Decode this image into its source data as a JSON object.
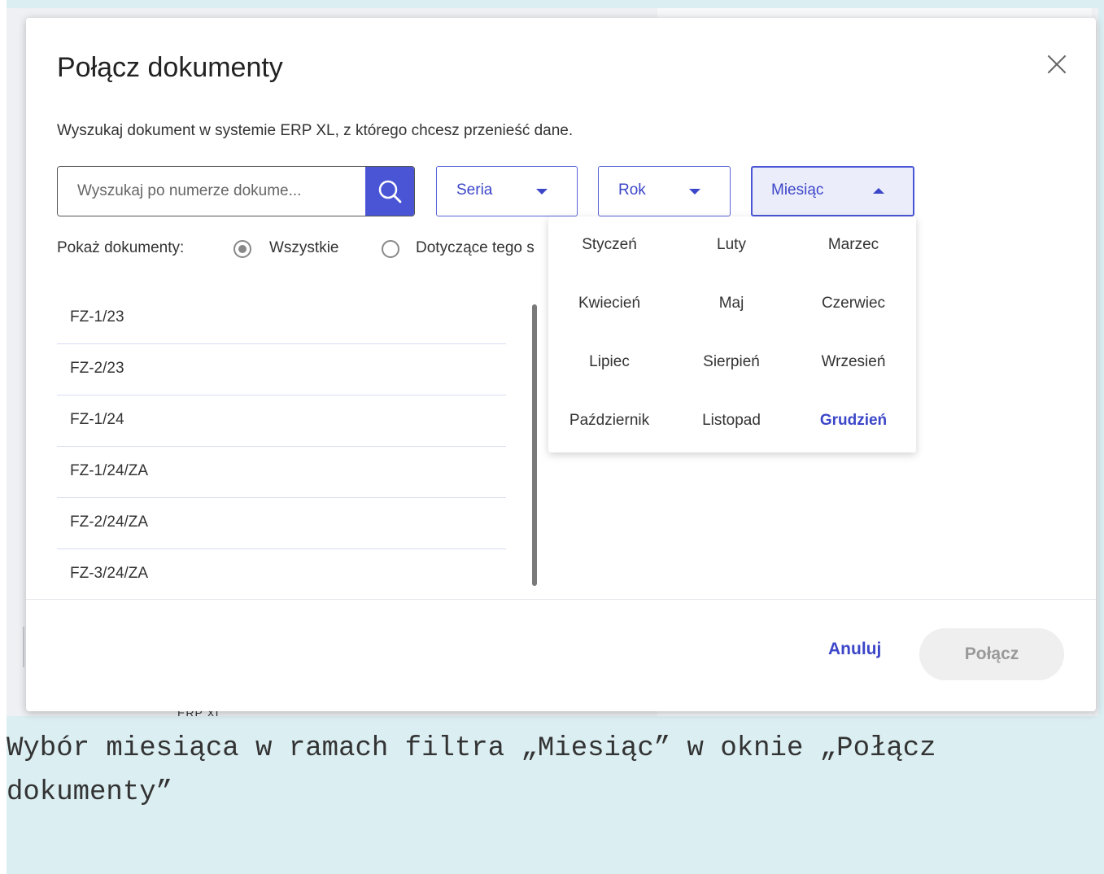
{
  "background": {
    "label": "ERP XL"
  },
  "dialog": {
    "title": "Połącz dokumenty",
    "subtitle": "Wyszukaj dokument w systemie ERP XL, z którego chcesz przenieść dane.",
    "search": {
      "placeholder": "Wyszukaj po numerze dokume..."
    },
    "filters": {
      "series_label": "Seria",
      "year_label": "Rok",
      "month_label": "Miesiąc"
    },
    "show_documents": {
      "label": "Pokaż dokumenty:",
      "options": [
        "Wszystkie",
        "Dotyczące tego s"
      ],
      "selected": "Wszystkie"
    },
    "documents": [
      "FZ-1/23",
      "FZ-2/23",
      "FZ-1/24",
      "FZ-1/24/ZA",
      "FZ-2/24/ZA",
      "FZ-3/24/ZA"
    ],
    "months": [
      "Styczeń",
      "Luty",
      "Marzec",
      "Kwiecień",
      "Maj",
      "Czerwiec",
      "Lipiec",
      "Sierpień",
      "Wrzesień",
      "Październik",
      "Listopad",
      "Grudzień"
    ],
    "selected_month": "Grudzień",
    "buttons": {
      "cancel": "Anuluj",
      "connect": "Połącz"
    }
  },
  "caption": {
    "line1": "Wybór miesiąca w ramach filtra „Miesiąc” w oknie „Połącz",
    "line2": "dokumenty”"
  },
  "colors": {
    "accent": "#4a55d6",
    "background": "#dbeef2",
    "selected_month": "#3c46c8"
  }
}
